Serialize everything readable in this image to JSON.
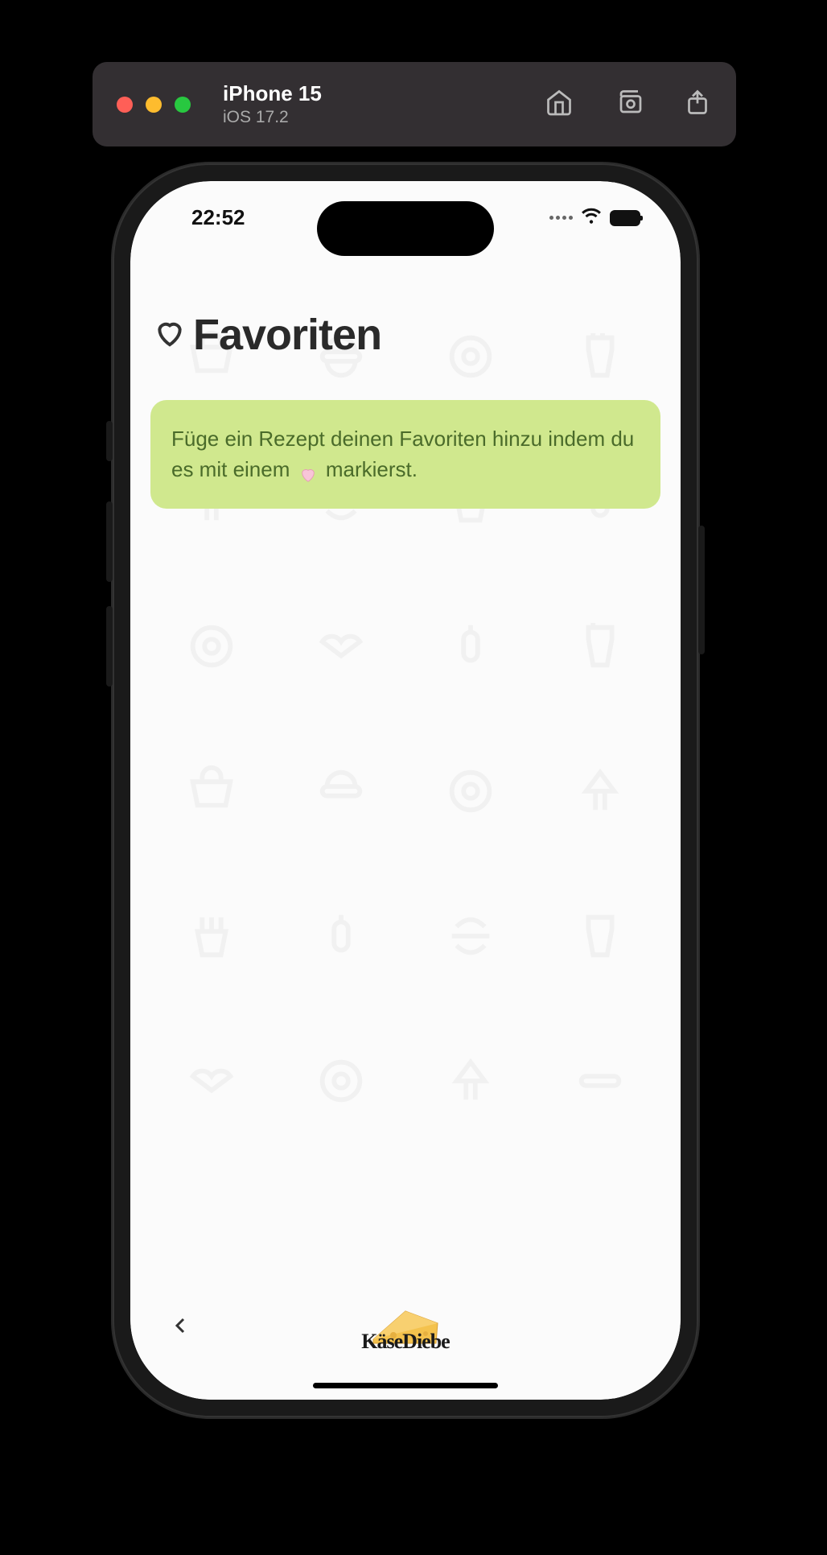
{
  "simulator": {
    "device": "iPhone 15",
    "os": "iOS 17.2"
  },
  "status": {
    "time": "22:52"
  },
  "page": {
    "title": "Favoriten"
  },
  "info": {
    "text_before": "Füge ein Rezept deinen Favoriten hinzu indem du es mit einem ",
    "text_after": " markierst."
  },
  "logo": {
    "text": "KäseDiebe"
  }
}
